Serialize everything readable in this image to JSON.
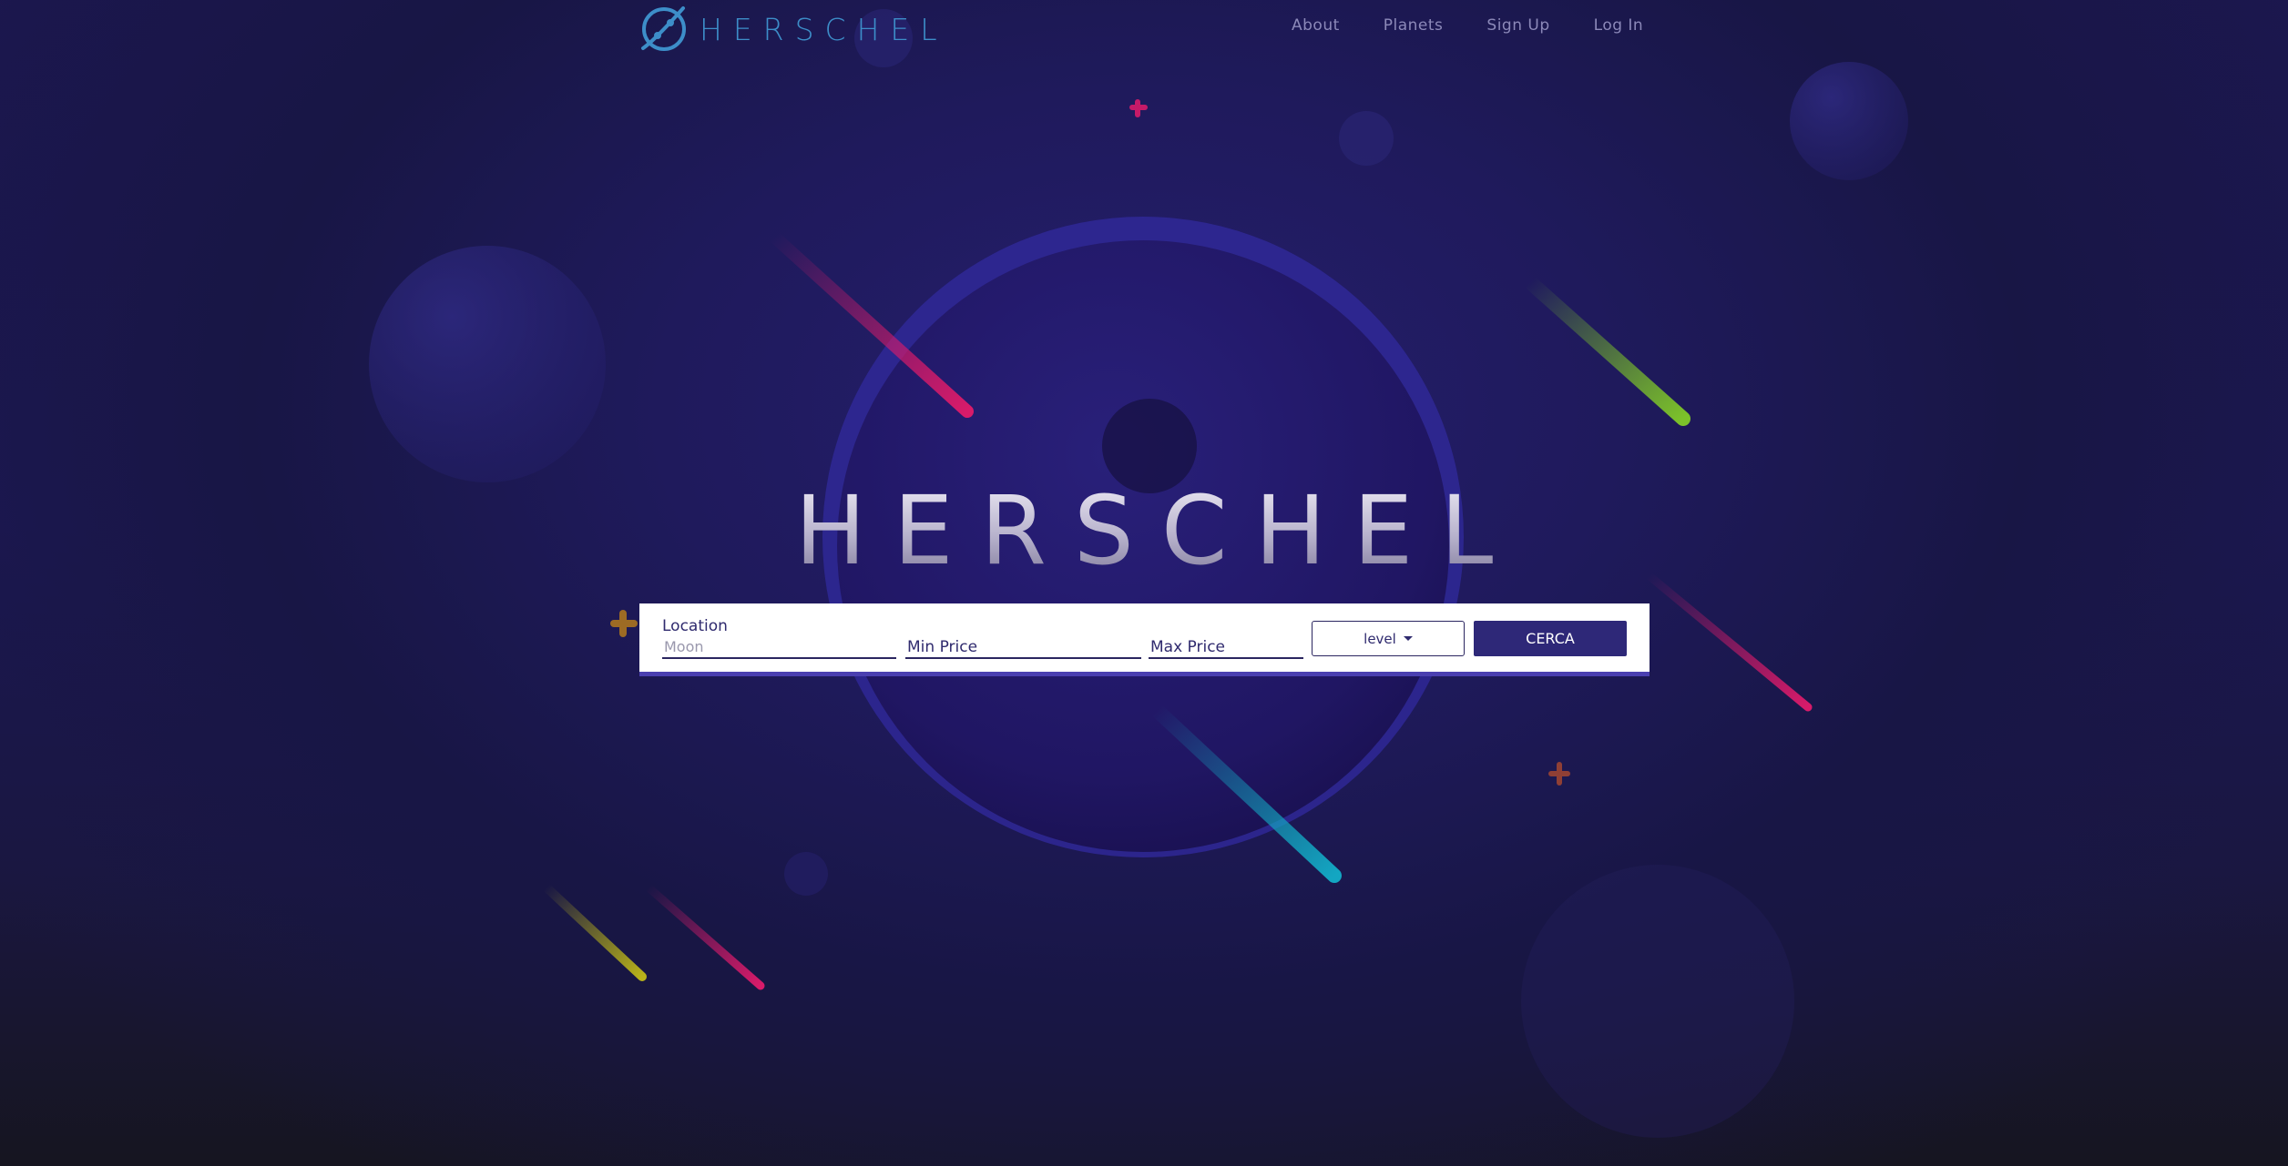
{
  "brand": {
    "name": "HERSCHEL"
  },
  "nav": {
    "items": [
      "About",
      "Planets",
      "Sign Up",
      "Log In"
    ]
  },
  "hero": {
    "title": "HERSCHEL"
  },
  "search": {
    "location_label": "Location",
    "location_placeholder": "Moon",
    "min_price_placeholder": "Min Price",
    "max_price_placeholder": "Max Price",
    "level_label": "level",
    "submit_label": "CERCA"
  },
  "colors": {
    "brand": "#3d8ec9",
    "button": "#2e2878",
    "accent_border": "#4a3fb0"
  },
  "icons": [
    "planet-logo-icon",
    "chevron-down-icon"
  ]
}
